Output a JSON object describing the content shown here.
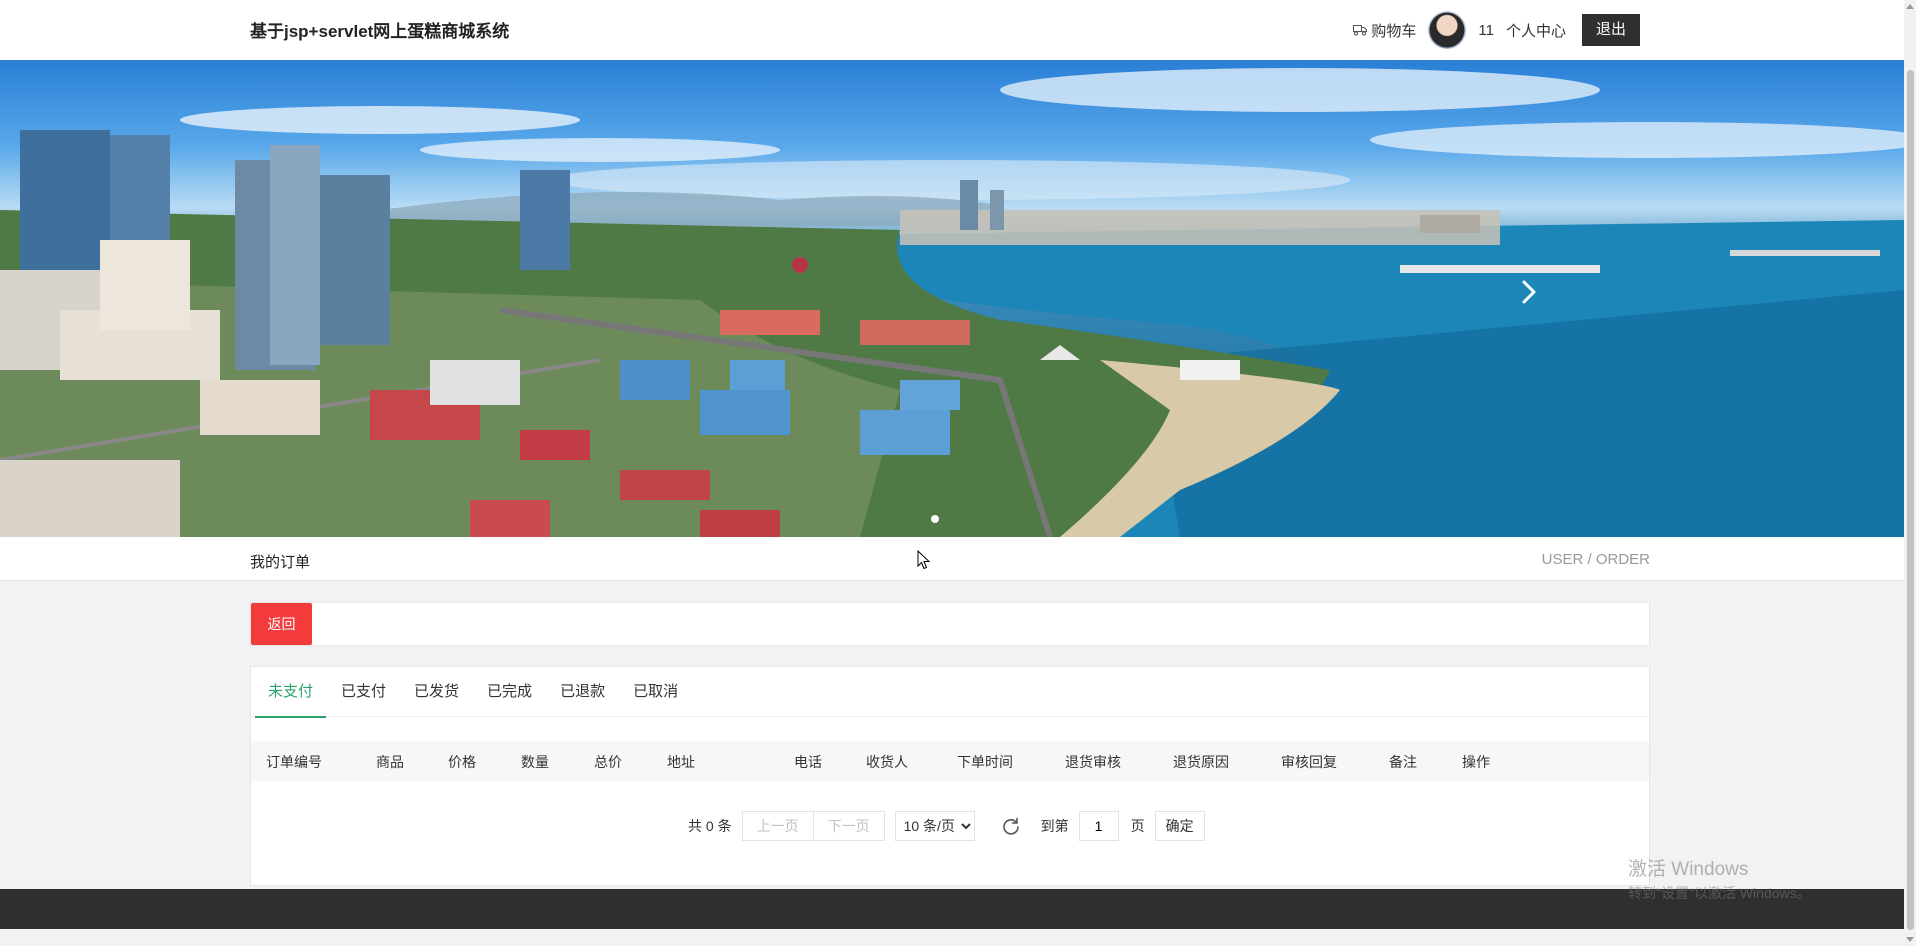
{
  "header": {
    "site_title": "基于jsp+servlet网上蛋糕商城系统",
    "cart_label": "购物车",
    "username": "11",
    "personal_center_label": "个人中心",
    "logout_label": "退出"
  },
  "banner": {
    "active_slide": 1,
    "slide_count": 1
  },
  "section": {
    "title": "我的订单",
    "path": "USER / ORDER"
  },
  "back_label": "返回",
  "tabs": [
    {
      "label": "未支付",
      "active": true
    },
    {
      "label": "已支付"
    },
    {
      "label": "已发货"
    },
    {
      "label": "已完成"
    },
    {
      "label": "已退款"
    },
    {
      "label": "已取消"
    }
  ],
  "table": {
    "columns": [
      "订单编号",
      "商品",
      "价格",
      "数量",
      "总价",
      "地址",
      "电话",
      "收货人",
      "下单时间",
      "退货审核",
      "退货原因",
      "审核回复",
      "备注",
      "操作"
    ],
    "rows": []
  },
  "pagination": {
    "total_text": "共 0 条",
    "prev_label": "上一页",
    "next_label": "下一页",
    "page_size_option": "10 条/页",
    "goto_label": "到第",
    "current_page": "1",
    "page_label": "页",
    "confirm_label": "确定"
  },
  "watermark": {
    "line1": "激活 Windows",
    "line2": "转到\"设置\"以激活 Windows。"
  },
  "colors": {
    "accent_green": "#2aa36b",
    "back_red": "#f43b3b",
    "dark": "#2f2f2f"
  }
}
